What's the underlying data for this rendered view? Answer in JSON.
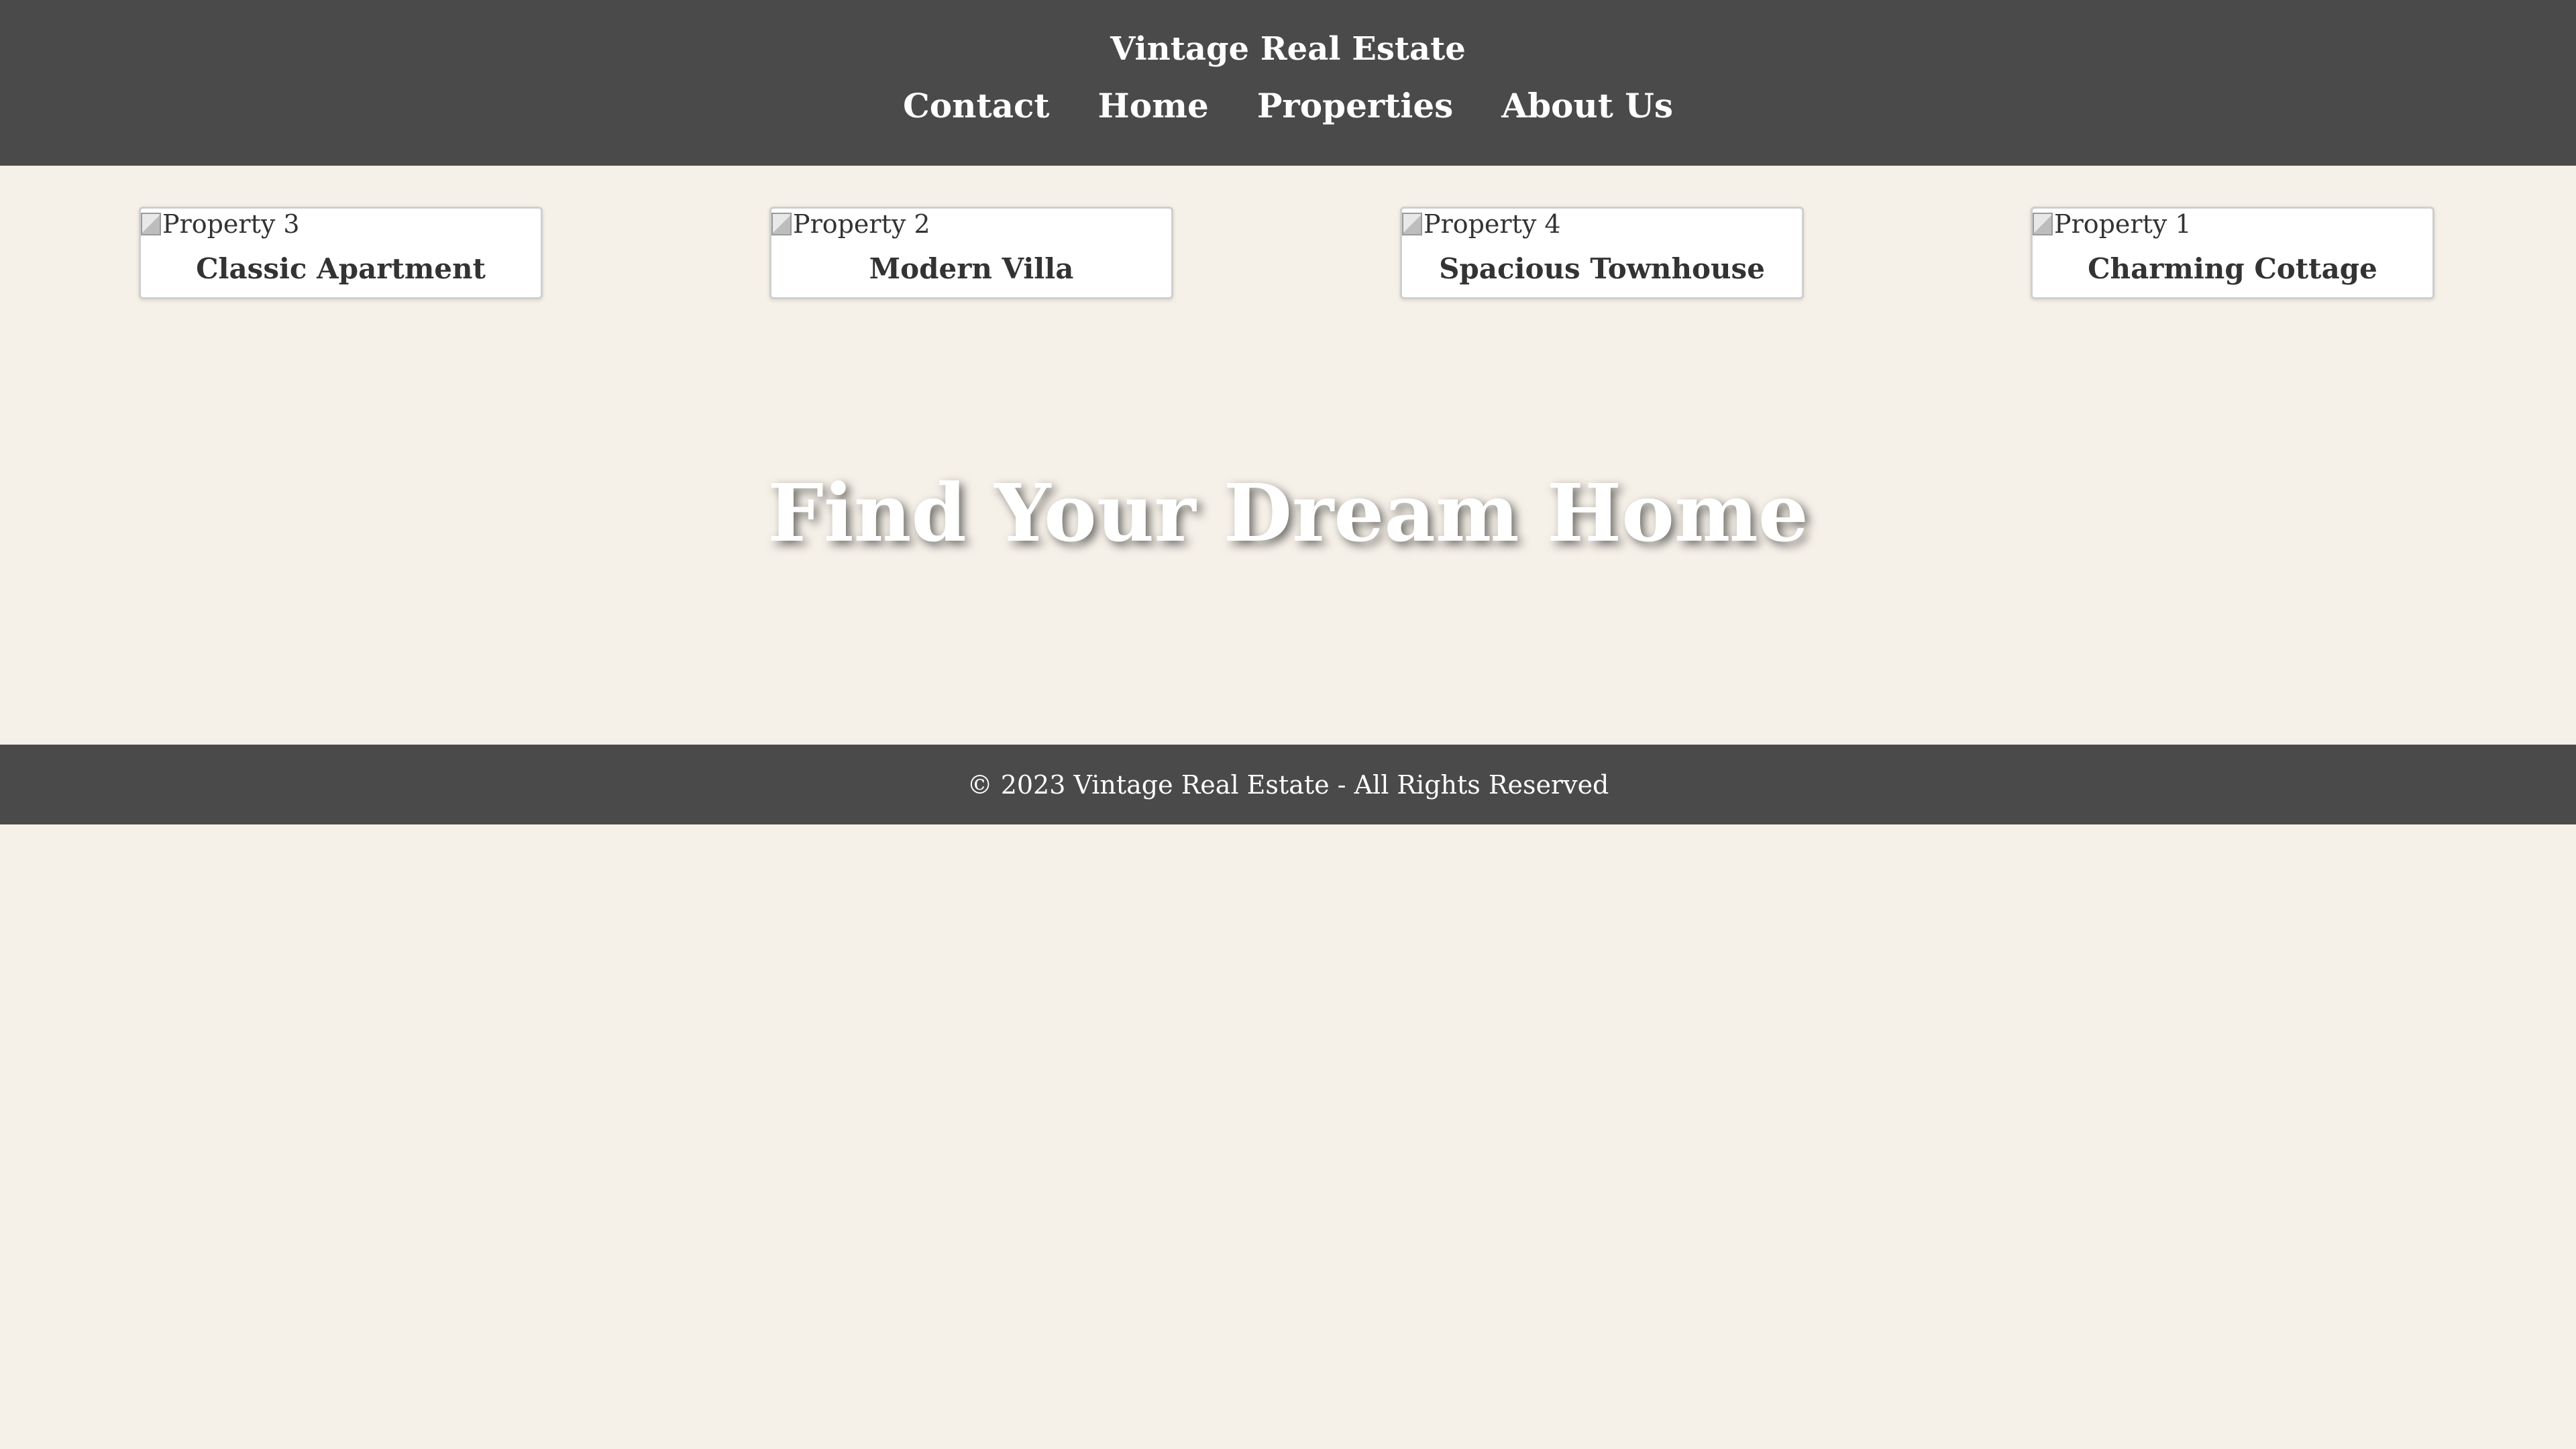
{
  "header": {
    "title": "Vintage Real Estate",
    "nav": [
      {
        "label": "Contact"
      },
      {
        "label": "Home"
      },
      {
        "label": "Properties"
      },
      {
        "label": "About Us"
      }
    ]
  },
  "properties": [
    {
      "image_alt": "Property 3",
      "title": "Classic Apartment"
    },
    {
      "image_alt": "Property 2",
      "title": "Modern Villa"
    },
    {
      "image_alt": "Property 4",
      "title": "Spacious Townhouse"
    },
    {
      "image_alt": "Property 1",
      "title": "Charming Cottage"
    }
  ],
  "hero": {
    "heading": "Find Your Dream Home"
  },
  "footer": {
    "text": "© 2023 Vintage Real Estate - All Rights Reserved"
  },
  "colors": {
    "header_bg": "#4a4a4a",
    "page_bg": "#f5f0e8",
    "card_bg": "#ffffff",
    "text_dark": "#333333",
    "text_light": "#ffffff"
  }
}
